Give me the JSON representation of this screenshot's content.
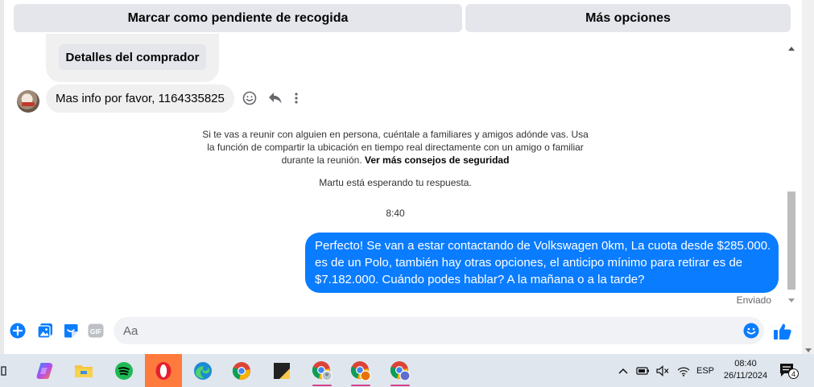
{
  "actions": {
    "pending_label": "Marcar como pendiente de recogida",
    "more_label": "Más opciones"
  },
  "listing": {
    "buyer_details_label": "Detalles del comprador"
  },
  "conversation": {
    "incoming_message": "Mas info por favor, 1164335825",
    "safety_notice": "Si te vas a reunir con alguien en persona, cuéntale a familiares y amigos adónde vas. Usa la función de compartir la ubicación en tiempo real directamente con un amigo o familiar durante la reunión.",
    "safety_link": "Ver más consejos de seguridad",
    "waiting_text": "Martu está esperando tu respuesta.",
    "timestamp": "8:40",
    "outgoing_lines": [
      "Perfecto!  Se van a estar contactando de Volkswagen 0km, La cuota desde $285.000.",
      "es de un Polo, también hay otras opciones, el anticipo mínimo para retirar es de",
      "$7.182.000. Cuándo podes hablar? A la mañana o a la tarde?"
    ],
    "sent_status": "Enviado",
    "accent_color": "#0a7cff"
  },
  "composer": {
    "placeholder": "Aa",
    "icons": [
      "plus-circle-icon",
      "image-icon",
      "sticker-icon",
      "gif-icon",
      "emoji-icon",
      "thumbs-up-icon"
    ]
  },
  "taskbar": {
    "apps": [
      "task-view-icon",
      "copilot-icon",
      "file-explorer-icon",
      "spotify-icon",
      "opera-icon",
      "edge-icon",
      "chrome-icon",
      "sticky-notes-icon",
      "chrome-profile-1-icon",
      "chrome-profile-2-icon",
      "chrome-profile-3-icon"
    ],
    "language": "ESP",
    "time": "08:40",
    "date": "26/11/2024",
    "notification_count": "4"
  }
}
